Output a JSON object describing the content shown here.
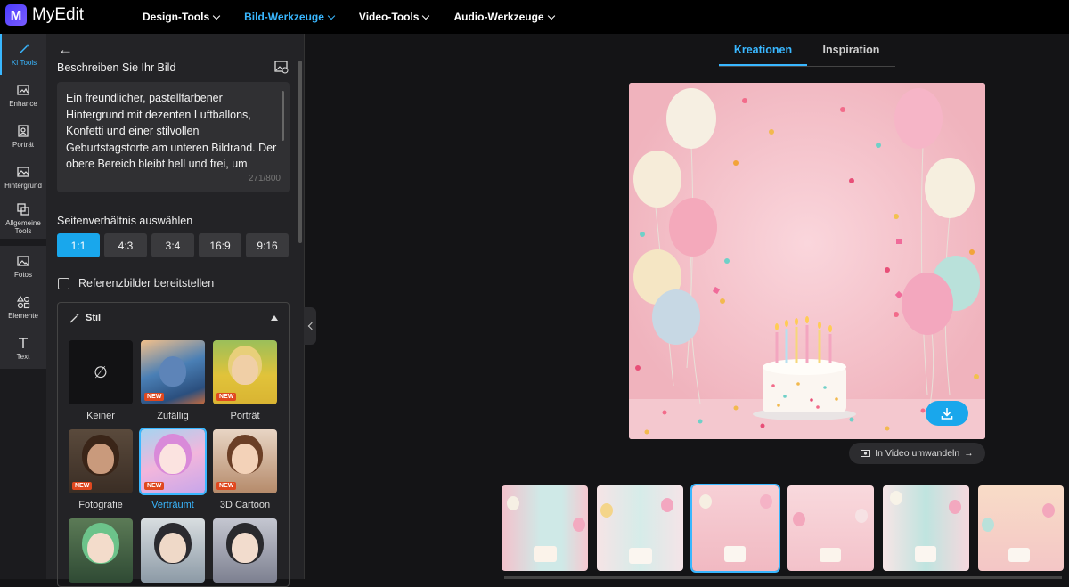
{
  "app": {
    "name": "MyEdit",
    "logo_letter": "M"
  },
  "nav": [
    {
      "label": "Design-Tools",
      "active": false
    },
    {
      "label": "Bild-Werkzeuge",
      "active": true
    },
    {
      "label": "Video-Tools",
      "active": false
    },
    {
      "label": "Audio-Werkzeuge",
      "active": false
    }
  ],
  "rail": {
    "ki_tools": "KI Tools",
    "enhance": "Enhance",
    "portrait": "Porträt",
    "hintergrund": "Hintergrund",
    "allgemeine": "Allgemeine Tools",
    "fotos": "Fotos",
    "elemente": "Elemente",
    "text": "Text"
  },
  "panel": {
    "describe_title": "Beschreiben Sie Ihr Bild",
    "prompt_text": "Ein freundlicher, pastellfarbener Hintergrund mit dezenten Luftballons, Konfetti und einer stilvollen Geburtstagstorte am unteren Bildrand. Der obere Bereich bleibt hell und frei, um",
    "counter": "271/800",
    "ratio_title": "Seitenverhältnis auswählen",
    "ratios": [
      "1:1",
      "4:3",
      "3:4",
      "16:9",
      "9:16"
    ],
    "selected_ratio": "1:1",
    "reference_label": "Referenzbilder bereitstellen",
    "style_title": "Stil",
    "styles": [
      {
        "label": "Keiner",
        "new": false,
        "selected": false
      },
      {
        "label": "Zufällig",
        "new": true,
        "selected": false
      },
      {
        "label": "Porträt",
        "new": true,
        "selected": false
      },
      {
        "label": "Fotografie",
        "new": true,
        "selected": false
      },
      {
        "label": "Verträumt",
        "new": true,
        "selected": true
      },
      {
        "label": "3D Cartoon",
        "new": true,
        "selected": false
      }
    ],
    "new_badge": "NEW"
  },
  "main": {
    "tabs": [
      "Kreationen",
      "Inspiration"
    ],
    "active_tab": "Kreationen",
    "video_button": "In Video umwandeln",
    "thumbnails_count": 6,
    "selected_thumbnail": 3
  },
  "colors": {
    "accent": "#39b7ff",
    "accent_fill": "#19a7ec",
    "new_badge": "#e0481f"
  }
}
